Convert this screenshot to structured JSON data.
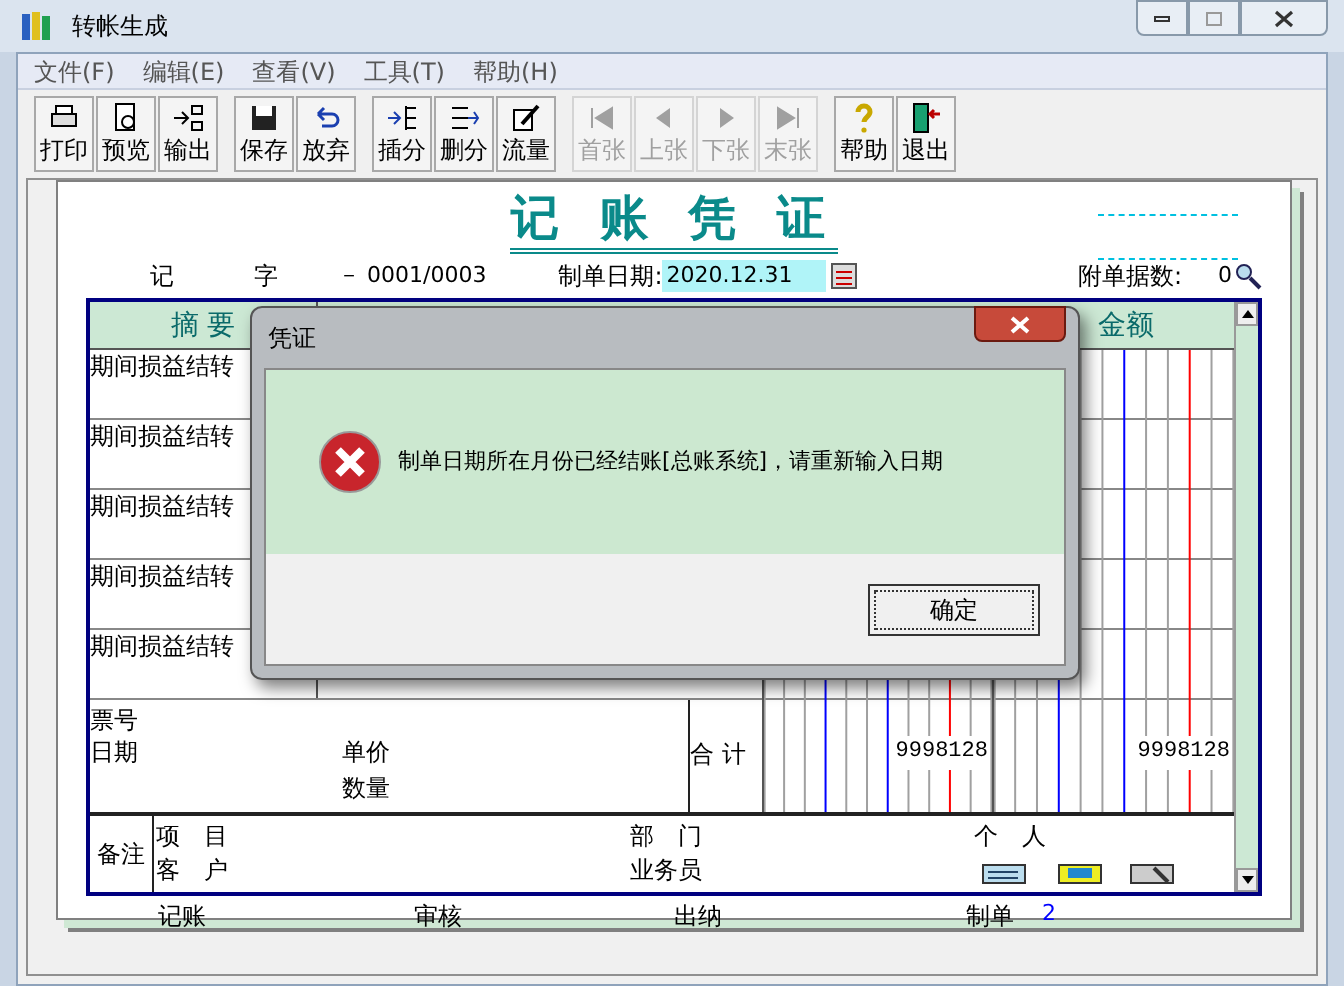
{
  "window": {
    "title": "转帐生成"
  },
  "menu": [
    {
      "label": "文件(F)"
    },
    {
      "label": "编辑(E)"
    },
    {
      "label": "查看(V)"
    },
    {
      "label": "工具(T)"
    },
    {
      "label": "帮助(H)"
    }
  ],
  "toolbar_groups": [
    [
      {
        "label": "打印",
        "disabled": false
      },
      {
        "label": "预览",
        "disabled": false
      },
      {
        "label": "输出",
        "disabled": false
      }
    ],
    [
      {
        "label": "保存",
        "disabled": false
      },
      {
        "label": "放弃",
        "disabled": false
      }
    ],
    [
      {
        "label": "插分",
        "disabled": false
      },
      {
        "label": "删分",
        "disabled": false
      },
      {
        "label": "流量",
        "disabled": false
      }
    ],
    [
      {
        "label": "首张",
        "disabled": true
      },
      {
        "label": "上张",
        "disabled": true
      },
      {
        "label": "下张",
        "disabled": true
      },
      {
        "label": "末张",
        "disabled": true
      }
    ],
    [
      {
        "label": "帮助",
        "disabled": false
      },
      {
        "label": "退出",
        "disabled": false
      }
    ]
  ],
  "voucher": {
    "title": "记 账 凭 证",
    "type_label": "记",
    "word_label": "字",
    "number": "－ 0001/0003",
    "date_label": "制单日期:",
    "date": "2020.12.31",
    "attachments_label": "附单据数:",
    "attachments": "0"
  },
  "table": {
    "columns": [
      "摘 要",
      "金额"
    ],
    "rows": [
      {
        "summary": "期间损益结转"
      },
      {
        "summary": "期间损益结转"
      },
      {
        "summary": "期间损益结转"
      },
      {
        "summary": "期间损益结转"
      },
      {
        "summary": "期间损益结转"
      }
    ],
    "footer": {
      "ticket_label": "票号",
      "date_label": "日期",
      "price_label": "单价",
      "quantity_label": "数量",
      "total_label": "合 计",
      "debit_total": "9998128",
      "credit_total": "9998128"
    },
    "notes": {
      "label": "备注",
      "project_label": "项　目",
      "customer_label": "客　户",
      "department_label": "部　门",
      "salesperson_label": "业务员",
      "person_label": "个　人"
    }
  },
  "signatures": [
    {
      "label": "记账"
    },
    {
      "label": "审核"
    },
    {
      "label": "出纳"
    },
    {
      "label": "制单",
      "value": "2"
    }
  ],
  "dialog": {
    "title": "凭证",
    "message": "制单日期所在月份已经结账[总账系统]，请重新输入日期",
    "button": "确定"
  }
}
